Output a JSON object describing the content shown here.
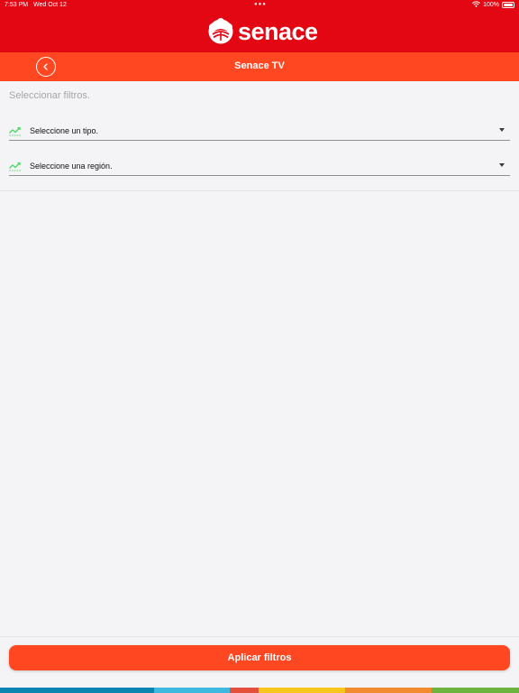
{
  "status_bar": {
    "time": "7:53 PM",
    "date": "Wed Oct 12",
    "battery": "100%"
  },
  "header": {
    "logo_text": "senace"
  },
  "nav": {
    "title": "Senace TV"
  },
  "filters": {
    "label": "Seleccionar filtros.",
    "type_select": {
      "text": "Seleccione un tipo."
    },
    "region_select": {
      "text": "Seleccione una región."
    }
  },
  "actions": {
    "apply_label": "Aplicar filtros"
  },
  "colors": {
    "header_red": "#e30613",
    "nav_orange": "#ff4822",
    "trend_green": "#4cd964",
    "stripe": [
      "#0a84b0",
      "#3fb8e0",
      "#e4503c",
      "#f7c61c",
      "#f28b2f",
      "#6db33f"
    ]
  },
  "icons": {
    "back": "chevron-left-icon",
    "trend": "trending-up-icon",
    "dropdown": "caret-down-icon"
  }
}
